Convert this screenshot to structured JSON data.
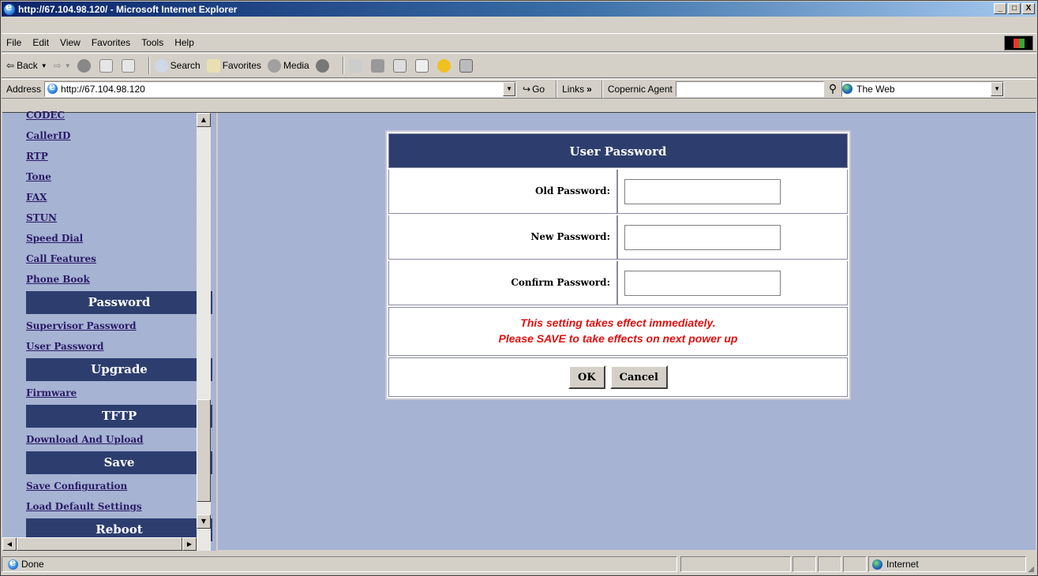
{
  "window": {
    "title": "http://67.104.98.120/ - Microsoft Internet Explorer",
    "buttons": [
      "_",
      "□",
      "X"
    ]
  },
  "menu": [
    "File",
    "Edit",
    "View",
    "Favorites",
    "Tools",
    "Help"
  ],
  "toolbar": {
    "back": "Back",
    "search": "Search",
    "favorites": "Favorites",
    "media": "Media"
  },
  "address": {
    "label": "Address",
    "url": "http://67.104.98.120",
    "go": "Go",
    "links": "Links",
    "copernic": "Copernic Agent",
    "the_web": "The Web"
  },
  "sidebar": {
    "items": [
      {
        "type": "link",
        "label": "CODEC"
      },
      {
        "type": "link",
        "label": "CallerID"
      },
      {
        "type": "link",
        "label": "RTP"
      },
      {
        "type": "link",
        "label": "Tone"
      },
      {
        "type": "link",
        "label": "FAX"
      },
      {
        "type": "link",
        "label": "STUN"
      },
      {
        "type": "link",
        "label": "Speed Dial"
      },
      {
        "type": "link",
        "label": "Call Features"
      },
      {
        "type": "link",
        "label": "Phone Book"
      },
      {
        "type": "header",
        "label": "Password"
      },
      {
        "type": "link",
        "label": "Supervisor Password"
      },
      {
        "type": "link",
        "label": "User Password"
      },
      {
        "type": "header",
        "label": "Upgrade"
      },
      {
        "type": "link",
        "label": "Firmware"
      },
      {
        "type": "header",
        "label": "TFTP"
      },
      {
        "type": "link",
        "label": "Download And Upload"
      },
      {
        "type": "header",
        "label": "Save"
      },
      {
        "type": "link",
        "label": "Save Configuration"
      },
      {
        "type": "link",
        "label": "Load Default Settings"
      },
      {
        "type": "header",
        "label": "Reboot"
      }
    ]
  },
  "form": {
    "title": "User Password",
    "old_label": "Old Password:",
    "new_label": "New Password:",
    "confirm_label": "Confirm Password:",
    "note_line1": "This setting takes effect immediately.",
    "note_line2": "Please SAVE to take effects on next power up",
    "ok": "OK",
    "cancel": "Cancel"
  },
  "status": {
    "text": "Done",
    "zone": "Internet"
  },
  "colors": {
    "page_bg": "#a6b3d3",
    "header_bg": "#2d3e6e",
    "note_red": "#e01010"
  }
}
